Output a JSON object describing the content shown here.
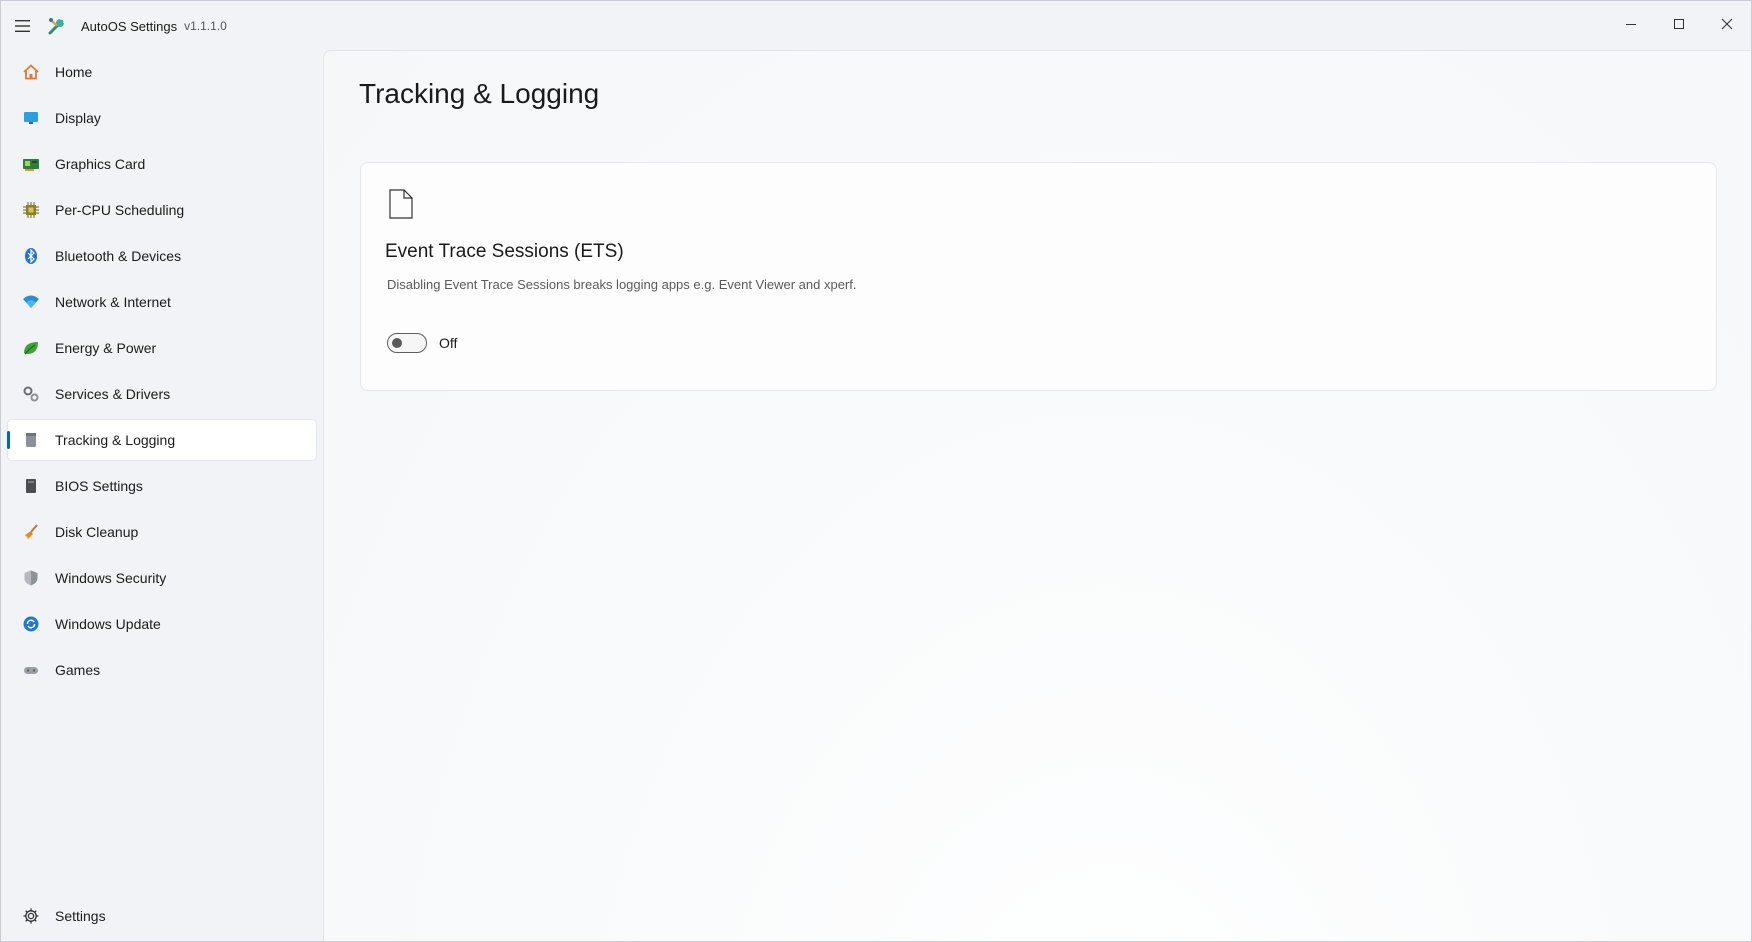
{
  "app": {
    "title": "AutoOS Settings",
    "version": "v1.1.1.0",
    "icon": "app-tools-icon",
    "accent_color": "#0067c0"
  },
  "window_controls": [
    "minimize-icon",
    "maximize-icon",
    "close-icon"
  ],
  "sidebar": {
    "items": [
      {
        "label": "Home",
        "icon": "home-icon"
      },
      {
        "label": "Display",
        "icon": "display-icon"
      },
      {
        "label": "Graphics Card",
        "icon": "graphics-card-icon"
      },
      {
        "label": "Per-CPU Scheduling",
        "icon": "cpu-icon"
      },
      {
        "label": "Bluetooth & Devices",
        "icon": "bluetooth-icon"
      },
      {
        "label": "Network & Internet",
        "icon": "wifi-icon"
      },
      {
        "label": "Energy & Power",
        "icon": "leaf-icon"
      },
      {
        "label": "Services & Drivers",
        "icon": "gears-icon"
      },
      {
        "label": "Tracking & Logging",
        "icon": "log-icon",
        "active": true
      },
      {
        "label": "BIOS Settings",
        "icon": "bios-chip-icon"
      },
      {
        "label": "Disk Cleanup",
        "icon": "broom-icon"
      },
      {
        "label": "Windows Security",
        "icon": "shield-icon"
      },
      {
        "label": "Windows Update",
        "icon": "update-icon"
      },
      {
        "label": "Games",
        "icon": "gamepad-icon"
      }
    ],
    "footer": {
      "label": "Settings",
      "icon": "gear-icon"
    }
  },
  "main": {
    "page_title": "Tracking & Logging",
    "card": {
      "icon": "document-icon",
      "title": "Event Trace Sessions (ETS)",
      "description": "Disabling Event Trace Sessions breaks logging apps e.g. Event Viewer and xperf.",
      "toggle": {
        "state": "off",
        "label": "Off"
      }
    }
  }
}
